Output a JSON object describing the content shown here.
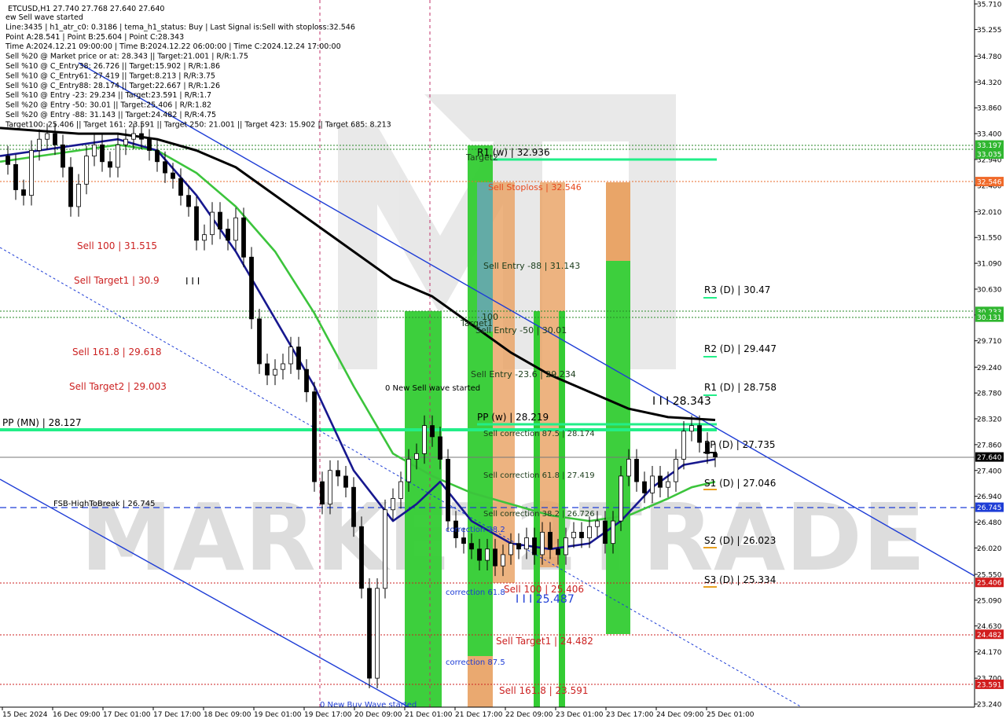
{
  "header": {
    "symbol_line": "ETCUSD,H1  27.740 27.768 27.640 27.640",
    "info_lines": [
      "ew Sell wave started",
      "Line:3435 | h1_atr_c0: 0.3186 | tema_h1_status: Buy | Last Signal is:Sell with stoploss:32.546",
      "Point A:28.541 | Point B:25.604 | Point C:28.343",
      "Time A:2024.12.21 09:00:00 | Time B:2024.12.22 06:00:00 | Time C:2024.12.24 17:00:00",
      "Sell %20 @ Market price or at: 28.343 || Target:21.001 | R/R:1.75",
      "Sell %10 @ C_Entry38: 26.726 || Target:15.902 | R/R:1.86",
      "Sell %10 @ C_Entry61: 27.419 || Target:8.213 | R/R:3.75",
      "Sell %10 @ C_Entry88: 28.174 || Target:22.667 | R/R:1.26",
      "Sell %10 @ Entry -23: 29.234 || Target:23.591 | R/R:1.7",
      "Sell %20 @ Entry -50: 30.01 || Target:25.406 | R/R:1.82",
      "Sell %20 @ Entry -88: 31.143 || Target:24.482 | R/R:4.75",
      "Target100: 25.406 || Target 161: 23.591 || Target 250: 21.001 || Target 423: 15.902 || Target 685: 8.213"
    ]
  },
  "watermark": "MARKET2TRADE",
  "price_badges": [
    {
      "label": "33.197",
      "bg": "#2fb62f"
    },
    {
      "label": "33.035",
      "bg": "#2fb62f"
    },
    {
      "label": "32.546",
      "bg": "#f06a2a"
    },
    {
      "label": "30.233",
      "bg": "#2fb62f"
    },
    {
      "label": "30.131",
      "bg": "#2fb62f"
    },
    {
      "label": "27.640",
      "bg": "#000000"
    },
    {
      "label": "26.745",
      "bg": "#1e3dd6"
    },
    {
      "label": "25.406",
      "bg": "#d11d1d"
    },
    {
      "label": "24.482",
      "bg": "#d11d1d"
    },
    {
      "label": "23.591",
      "bg": "#d11d1d"
    }
  ],
  "chart_annotations": {
    "left_labels": [
      {
        "text": "Sell 100 | 31.515"
      },
      {
        "text": "Sell Target1 | 30.9"
      },
      {
        "text": "Sell 161.8 | 29.618"
      },
      {
        "text": "Sell Target2 | 29.003"
      }
    ],
    "pivot_labels": [
      {
        "text": "R1 (w) | 32.936",
        "color": "#000"
      },
      {
        "text": "PP (w) | 28.219",
        "color": "#000"
      },
      {
        "text": "PP (MN) | 28.127",
        "color": "#000"
      },
      {
        "text": "R3 (D) | 30.47",
        "color": "#000"
      },
      {
        "text": "R2 (D) | 29.447",
        "color": "#000"
      },
      {
        "text": "R1 (D) | 28.758",
        "color": "#000"
      },
      {
        "text": "PP (D) | 27.735",
        "color": "#000"
      },
      {
        "text": "S1 (D) | 27.046",
        "color": "#000"
      },
      {
        "text": "S2 (D) | 26.023",
        "color": "#000"
      },
      {
        "text": "S3 (D) | 25.334",
        "color": "#000"
      }
    ],
    "middle_labels": [
      {
        "text": "Sell Stoploss | 32.546",
        "color": "#e8481c"
      },
      {
        "text": "Sell Entry -88 | 31.143",
        "color": "#1b3c1b"
      },
      {
        "text": "Sell Entry -50 | 30.01",
        "color": "#1b3c1b"
      },
      {
        "text": "Sell Entry -23.6 | 29.234",
        "color": "#1b3c1b"
      },
      {
        "text": "0 New Sell wave started",
        "color": "#000"
      },
      {
        "text": "Sell correction 87.5 | 28.174",
        "color": "#1b3c1b"
      },
      {
        "text": "Sell correction 61.8 | 27.419",
        "color": "#1b3c1b"
      },
      {
        "text": "Sell correction 38.2 | 26.726",
        "color": "#1b3c1b"
      },
      {
        "text": "Sell 100 | 25.406",
        "color": "#c22"
      },
      {
        "text": "Sell Target1 | 24.482",
        "color": "#c22"
      },
      {
        "text": "Sell 161.8 | 23.591",
        "color": "#c22"
      },
      {
        "text": "correction 38.2",
        "color": "#1e3dd6"
      },
      {
        "text": "correction 61.8",
        "color": "#1e3dd6"
      },
      {
        "text": "correction 87.5",
        "color": "#1e3dd6"
      },
      {
        "text": "0 New Buy Wave started",
        "color": "#1e3dd6"
      },
      {
        "text": "I I I 28.343",
        "color": "#000"
      },
      {
        "text": "I I I 25.487",
        "color": "#1e3dd6"
      },
      {
        "text": "I I I",
        "color": "#000"
      },
      {
        "text": "FSB-HighToBreak | 26.745",
        "color": "#000"
      },
      {
        "text": "Target2",
        "color": "#1b3c1b"
      },
      {
        "text": "Target1",
        "color": "#1b3c1b"
      },
      {
        "text": "100",
        "color": "#1b3c1b"
      }
    ]
  },
  "chart_data": {
    "type": "line",
    "title": "ETCUSD,H1",
    "y_ticks": [
      "35.710",
      "35.255",
      "34.780",
      "34.320",
      "33.860",
      "33.400",
      "32.940",
      "32.480",
      "32.010",
      "31.550",
      "31.090",
      "30.630",
      "30.170",
      "29.710",
      "29.240",
      "28.780",
      "28.320",
      "27.860",
      "27.400",
      "26.940",
      "26.480",
      "26.020",
      "25.550",
      "25.090",
      "24.630",
      "24.170",
      "23.700",
      "23.240"
    ],
    "ylim": [
      23.24,
      35.71
    ],
    "x_ticks": [
      "15 Dec 2024",
      "16 Dec 09:00",
      "17 Dec 01:00",
      "17 Dec 17:00",
      "18 Dec 09:00",
      "19 Dec 01:00",
      "19 Dec 17:00",
      "20 Dec 09:00",
      "21 Dec 01:00",
      "21 Dec 17:00",
      "22 Dec 09:00",
      "23 Dec 01:00",
      "23 Dec 17:00",
      "24 Dec 09:00",
      "25 Dec 01:00"
    ],
    "close_series": [
      [
        0,
        33.0
      ],
      [
        10,
        32.85
      ],
      [
        20,
        32.4
      ],
      [
        30,
        32.3
      ],
      [
        40,
        33.1
      ],
      [
        50,
        33.3
      ],
      [
        60,
        33.4
      ],
      [
        70,
        33.2
      ],
      [
        80,
        32.8
      ],
      [
        90,
        32.1
      ],
      [
        100,
        32.5
      ],
      [
        110,
        33.0
      ],
      [
        120,
        33.2
      ],
      [
        130,
        32.9
      ],
      [
        140,
        32.8
      ],
      [
        150,
        33.2
      ],
      [
        160,
        33.3
      ],
      [
        170,
        33.4
      ],
      [
        180,
        33.3
      ],
      [
        190,
        33.1
      ],
      [
        200,
        32.9
      ],
      [
        210,
        32.7
      ],
      [
        220,
        32.6
      ],
      [
        230,
        32.3
      ],
      [
        240,
        32.1
      ],
      [
        250,
        31.5
      ],
      [
        260,
        31.6
      ],
      [
        270,
        32.0
      ],
      [
        280,
        31.7
      ],
      [
        290,
        31.5
      ],
      [
        300,
        31.9
      ],
      [
        310,
        31.2
      ],
      [
        320,
        30.1
      ],
      [
        330,
        29.3
      ],
      [
        340,
        29.1
      ],
      [
        350,
        29.2
      ],
      [
        360,
        29.3
      ],
      [
        370,
        29.6
      ],
      [
        380,
        29.2
      ],
      [
        390,
        28.8
      ],
      [
        400,
        27.2
      ],
      [
        410,
        26.8
      ],
      [
        420,
        27.4
      ],
      [
        430,
        27.3
      ],
      [
        440,
        27.1
      ],
      [
        450,
        26.4
      ],
      [
        460,
        25.3
      ],
      [
        470,
        23.7
      ],
      [
        480,
        25.3
      ],
      [
        490,
        26.7
      ],
      [
        500,
        26.9
      ],
      [
        510,
        27.2
      ],
      [
        520,
        27.6
      ],
      [
        530,
        27.7
      ],
      [
        540,
        28.2
      ],
      [
        550,
        28.0
      ],
      [
        560,
        27.6
      ],
      [
        570,
        26.5
      ],
      [
        580,
        26.2
      ],
      [
        590,
        26.1
      ],
      [
        600,
        26.0
      ],
      [
        610,
        25.8
      ],
      [
        620,
        26.0
      ],
      [
        630,
        25.7
      ],
      [
        640,
        25.9
      ],
      [
        650,
        26.1
      ],
      [
        660,
        26.0
      ],
      [
        670,
        26.2
      ],
      [
        680,
        25.9
      ],
      [
        690,
        26.3
      ],
      [
        700,
        26.0
      ],
      [
        710,
        25.9
      ],
      [
        720,
        26.2
      ],
      [
        730,
        26.3
      ],
      [
        740,
        26.2
      ],
      [
        750,
        26.4
      ],
      [
        760,
        26.5
      ],
      [
        770,
        26.1
      ],
      [
        780,
        26.5
      ],
      [
        790,
        27.3
      ],
      [
        800,
        27.6
      ],
      [
        810,
        27.2
      ],
      [
        820,
        27.0
      ],
      [
        830,
        27.3
      ],
      [
        840,
        27.1
      ],
      [
        850,
        27.2
      ],
      [
        860,
        27.6
      ],
      [
        870,
        28.1
      ],
      [
        880,
        28.2
      ],
      [
        890,
        27.9
      ],
      [
        900,
        27.7
      ],
      [
        910,
        27.64
      ]
    ],
    "series": [
      {
        "color": "#000000",
        "points": [
          [
            0,
            33.5
          ],
          [
            50,
            33.45
          ],
          [
            100,
            33.4
          ],
          [
            150,
            33.4
          ],
          [
            200,
            33.3
          ],
          [
            250,
            33.1
          ],
          [
            300,
            32.8
          ],
          [
            350,
            32.3
          ],
          [
            400,
            31.8
          ],
          [
            450,
            31.3
          ],
          [
            500,
            30.8
          ],
          [
            550,
            30.5
          ],
          [
            600,
            30.0
          ],
          [
            650,
            29.5
          ],
          [
            700,
            29.1
          ],
          [
            750,
            28.8
          ],
          [
            800,
            28.5
          ],
          [
            850,
            28.35
          ],
          [
            910,
            28.3
          ]
        ]
      },
      {
        "color": "#3cc43c",
        "points": [
          [
            0,
            32.9
          ],
          [
            50,
            33.0
          ],
          [
            100,
            33.1
          ],
          [
            150,
            33.2
          ],
          [
            200,
            33.1
          ],
          [
            250,
            32.7
          ],
          [
            300,
            32.1
          ],
          [
            350,
            31.3
          ],
          [
            400,
            30.2
          ],
          [
            450,
            28.9
          ],
          [
            500,
            27.7
          ],
          [
            550,
            27.3
          ],
          [
            600,
            27.0
          ],
          [
            650,
            26.8
          ],
          [
            700,
            26.6
          ],
          [
            750,
            26.5
          ],
          [
            800,
            26.6
          ],
          [
            850,
            26.9
          ],
          [
            880,
            27.1
          ],
          [
            910,
            27.2
          ]
        ]
      },
      {
        "color": "#17188f",
        "points": [
          [
            0,
            33.0
          ],
          [
            50,
            33.1
          ],
          [
            100,
            33.2
          ],
          [
            150,
            33.3
          ],
          [
            200,
            33.1
          ],
          [
            250,
            32.3
          ],
          [
            300,
            31.3
          ],
          [
            350,
            30.1
          ],
          [
            400,
            28.9
          ],
          [
            450,
            27.4
          ],
          [
            500,
            26.5
          ],
          [
            530,
            26.8
          ],
          [
            560,
            27.2
          ],
          [
            600,
            26.5
          ],
          [
            650,
            26.1
          ],
          [
            700,
            26.0
          ],
          [
            750,
            26.1
          ],
          [
            790,
            26.5
          ],
          [
            830,
            27.1
          ],
          [
            870,
            27.5
          ],
          [
            910,
            27.6
          ]
        ]
      }
    ]
  }
}
